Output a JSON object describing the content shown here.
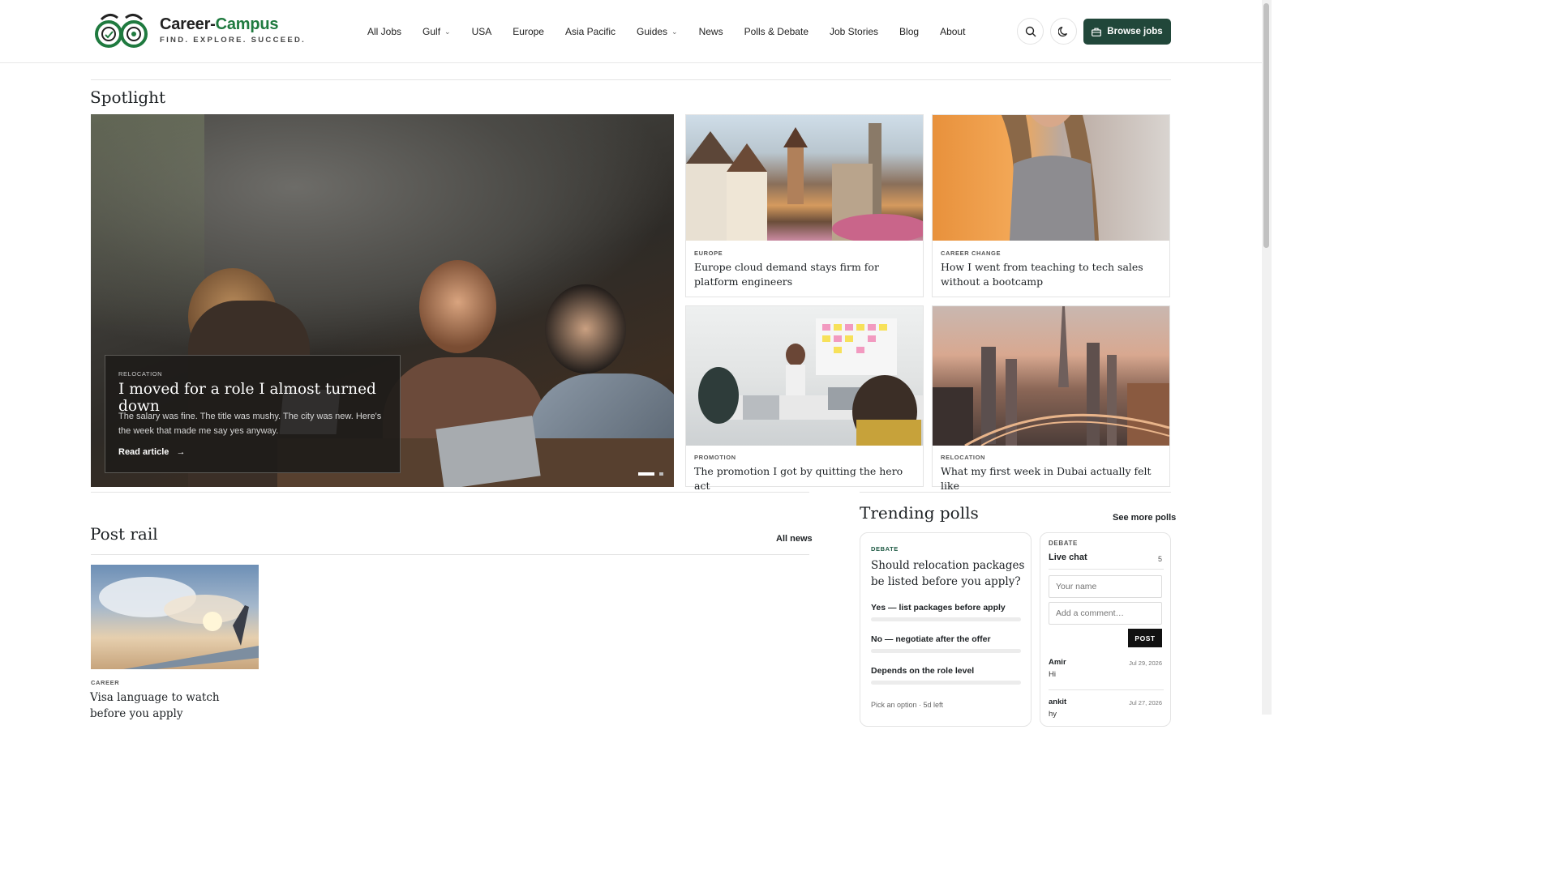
{
  "brand": {
    "name_part1": "Career-",
    "name_part2": "Campus",
    "tagline": "FIND. EXPLORE. SUCCEED.",
    "accent_color": "#1f7a3f"
  },
  "nav": {
    "items": [
      {
        "label": "All Jobs",
        "dropdown": false
      },
      {
        "label": "Gulf",
        "dropdown": true
      },
      {
        "label": "USA",
        "dropdown": false
      },
      {
        "label": "Europe",
        "dropdown": false
      },
      {
        "label": "Asia Pacific",
        "dropdown": false
      },
      {
        "label": "Guides",
        "dropdown": true
      },
      {
        "label": "News",
        "dropdown": false
      },
      {
        "label": "Polls & Debate",
        "dropdown": false
      },
      {
        "label": "Job Stories",
        "dropdown": false
      },
      {
        "label": "Blog",
        "dropdown": false
      },
      {
        "label": "About",
        "dropdown": false
      }
    ],
    "chevron_glyph": "⌄",
    "browse_label": "Browse jobs",
    "browse_color": "#21473a"
  },
  "spotlight": {
    "heading": "Spotlight",
    "hero": {
      "eyebrow": "RELOCATION",
      "title": "I moved for a role I almost turned down",
      "excerpt": "The salary was fine. The title was mushy. The city was new. Here's the week that made me say yes anyway.",
      "link_label": "Read article"
    },
    "cards": [
      {
        "eyebrow": "EUROPE",
        "title": "Europe cloud demand stays firm for platform engineers"
      },
      {
        "eyebrow": "CAREER CHANGE",
        "title": "How I went from teaching to tech sales without a bootcamp"
      },
      {
        "eyebrow": "PROMOTION",
        "title": "The promotion I got by quitting the hero act"
      },
      {
        "eyebrow": "RELOCATION",
        "title": "What my first week in Dubai actually felt like"
      }
    ]
  },
  "post_rail": {
    "heading": "Post rail",
    "all_link": "All news",
    "posts": [
      {
        "eyebrow": "CAREER",
        "title": "Visa language to watch before you apply"
      }
    ]
  },
  "polls": {
    "heading": "Trending polls",
    "see_more": "See more polls",
    "poll": {
      "eyebrow": "DEBATE",
      "question": "Should relocation packages be listed before you apply?",
      "options": [
        "Yes — list packages before apply",
        "No — negotiate after the offer",
        "Depends on the role level"
      ],
      "footer": "Pick an option · 5d left"
    },
    "chat": {
      "eyebrow": "DEBATE",
      "title": "Live chat",
      "count": "5",
      "name_placeholder": "Your name",
      "comment_placeholder": "Add a comment…",
      "post_label": "POST",
      "messages": [
        {
          "name": "Amir",
          "date": "Jul 29, 2026",
          "text": "Hi"
        },
        {
          "name": "ankit",
          "date": "Jul 27, 2026",
          "text": "hy"
        }
      ]
    }
  }
}
